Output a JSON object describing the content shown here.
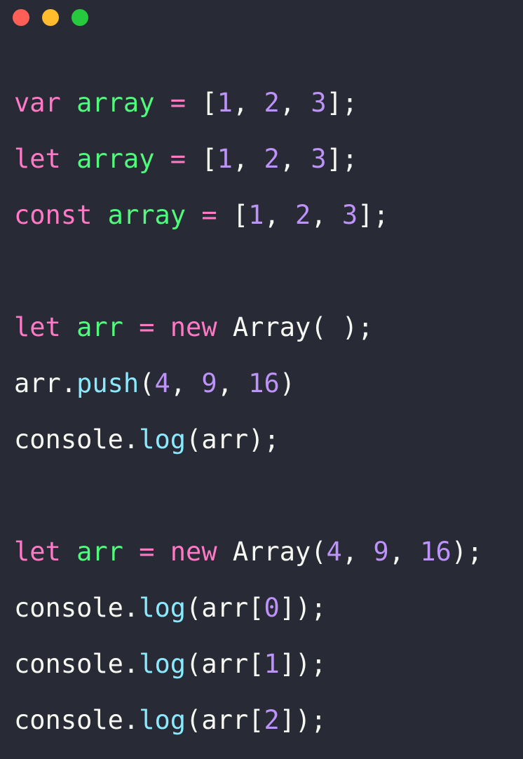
{
  "window": {
    "controls": [
      {
        "name": "close",
        "color": "#ff5f56"
      },
      {
        "name": "minimize",
        "color": "#ffbd2e"
      },
      {
        "name": "maximize",
        "color": "#27c93f"
      }
    ]
  },
  "colors": {
    "background": "#282a36",
    "keyword": "#ff79c6",
    "identifier": "#50fa7b",
    "operator": "#ff79c6",
    "number": "#bd93f9",
    "function": "#8be9fd",
    "plain": "#f8f8f2"
  },
  "code": {
    "lines": [
      {
        "tokens": [
          {
            "t": "var",
            "k": "keyword"
          },
          {
            "t": " ",
            "k": "plain"
          },
          {
            "t": "array",
            "k": "ident"
          },
          {
            "t": " ",
            "k": "plain"
          },
          {
            "t": "=",
            "k": "op"
          },
          {
            "t": " [",
            "k": "plain"
          },
          {
            "t": "1",
            "k": "num"
          },
          {
            "t": ", ",
            "k": "plain"
          },
          {
            "t": "2",
            "k": "num"
          },
          {
            "t": ", ",
            "k": "plain"
          },
          {
            "t": "3",
            "k": "num"
          },
          {
            "t": "];",
            "k": "plain"
          }
        ]
      },
      {
        "tokens": [
          {
            "t": "let",
            "k": "keyword"
          },
          {
            "t": " ",
            "k": "plain"
          },
          {
            "t": "array",
            "k": "ident"
          },
          {
            "t": " ",
            "k": "plain"
          },
          {
            "t": "=",
            "k": "op"
          },
          {
            "t": " [",
            "k": "plain"
          },
          {
            "t": "1",
            "k": "num"
          },
          {
            "t": ", ",
            "k": "plain"
          },
          {
            "t": "2",
            "k": "num"
          },
          {
            "t": ", ",
            "k": "plain"
          },
          {
            "t": "3",
            "k": "num"
          },
          {
            "t": "];",
            "k": "plain"
          }
        ]
      },
      {
        "tokens": [
          {
            "t": "const",
            "k": "keyword"
          },
          {
            "t": " ",
            "k": "plain"
          },
          {
            "t": "array",
            "k": "ident"
          },
          {
            "t": " ",
            "k": "plain"
          },
          {
            "t": "=",
            "k": "op"
          },
          {
            "t": " [",
            "k": "plain"
          },
          {
            "t": "1",
            "k": "num"
          },
          {
            "t": ", ",
            "k": "plain"
          },
          {
            "t": "2",
            "k": "num"
          },
          {
            "t": ", ",
            "k": "plain"
          },
          {
            "t": "3",
            "k": "num"
          },
          {
            "t": "];",
            "k": "plain"
          }
        ]
      },
      {
        "tokens": []
      },
      {
        "tokens": [
          {
            "t": "let",
            "k": "keyword"
          },
          {
            "t": " ",
            "k": "plain"
          },
          {
            "t": "arr",
            "k": "ident"
          },
          {
            "t": " ",
            "k": "plain"
          },
          {
            "t": "=",
            "k": "op"
          },
          {
            "t": " ",
            "k": "plain"
          },
          {
            "t": "new",
            "k": "keyword"
          },
          {
            "t": " Array( );",
            "k": "plain"
          }
        ]
      },
      {
        "tokens": [
          {
            "t": "arr.",
            "k": "plain"
          },
          {
            "t": "push",
            "k": "func"
          },
          {
            "t": "(",
            "k": "plain"
          },
          {
            "t": "4",
            "k": "num"
          },
          {
            "t": ", ",
            "k": "plain"
          },
          {
            "t": "9",
            "k": "num"
          },
          {
            "t": ", ",
            "k": "plain"
          },
          {
            "t": "16",
            "k": "num"
          },
          {
            "t": ")",
            "k": "plain"
          }
        ]
      },
      {
        "tokens": [
          {
            "t": "console.",
            "k": "plain"
          },
          {
            "t": "log",
            "k": "func"
          },
          {
            "t": "(arr);",
            "k": "plain"
          }
        ]
      },
      {
        "tokens": []
      },
      {
        "tokens": [
          {
            "t": "let",
            "k": "keyword"
          },
          {
            "t": " ",
            "k": "plain"
          },
          {
            "t": "arr",
            "k": "ident"
          },
          {
            "t": " ",
            "k": "plain"
          },
          {
            "t": "=",
            "k": "op"
          },
          {
            "t": " ",
            "k": "plain"
          },
          {
            "t": "new",
            "k": "keyword"
          },
          {
            "t": " Array(",
            "k": "plain"
          },
          {
            "t": "4",
            "k": "num"
          },
          {
            "t": ", ",
            "k": "plain"
          },
          {
            "t": "9",
            "k": "num"
          },
          {
            "t": ", ",
            "k": "plain"
          },
          {
            "t": "16",
            "k": "num"
          },
          {
            "t": ");",
            "k": "plain"
          }
        ]
      },
      {
        "tokens": [
          {
            "t": "console.",
            "k": "plain"
          },
          {
            "t": "log",
            "k": "func"
          },
          {
            "t": "(arr[",
            "k": "plain"
          },
          {
            "t": "0",
            "k": "num"
          },
          {
            "t": "]);",
            "k": "plain"
          }
        ]
      },
      {
        "tokens": [
          {
            "t": "console.",
            "k": "plain"
          },
          {
            "t": "log",
            "k": "func"
          },
          {
            "t": "(arr[",
            "k": "plain"
          },
          {
            "t": "1",
            "k": "num"
          },
          {
            "t": "]);",
            "k": "plain"
          }
        ]
      },
      {
        "tokens": [
          {
            "t": "console.",
            "k": "plain"
          },
          {
            "t": "log",
            "k": "func"
          },
          {
            "t": "(arr[",
            "k": "plain"
          },
          {
            "t": "2",
            "k": "num"
          },
          {
            "t": "]);",
            "k": "plain"
          }
        ]
      }
    ]
  }
}
